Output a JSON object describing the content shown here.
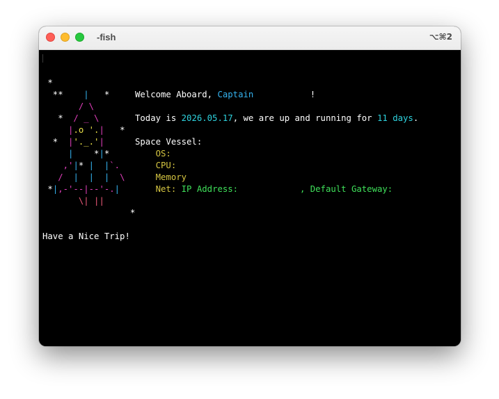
{
  "window": {
    "title": "-fish",
    "shortcut": "⌥⌘2"
  },
  "art": {
    "l1": [
      " *"
    ],
    "l2": [
      "  **    ",
      "|",
      "   *"
    ],
    "l3": [
      "       ",
      "/ \\"
    ],
    "l4": [
      "   *  ",
      "/ _ \\"
    ],
    "l5": [
      "     ",
      "|",
      ".o '.",
      "|",
      "   *"
    ],
    "l6": [
      "  *  ",
      "|",
      "'._.'",
      "|"
    ],
    "l7": [
      "     ",
      "|",
      "    *",
      "|",
      "*"
    ],
    "l8": [
      "    ",
      ",'",
      "|",
      "*",
      " ",
      "|",
      "  ",
      "|",
      "`.",
      ""
    ],
    "l9": [
      "   ",
      "/",
      "  ",
      "|",
      "  ",
      "|",
      "  ",
      "|",
      "  ",
      "\\"
    ],
    "l10": [
      " *",
      "|",
      ",-'--|--'-.",
      "|"
    ],
    "l11": [
      "       ",
      "\\| ||"
    ],
    "l12": [
      "                 *"
    ]
  },
  "info": {
    "welcome_prefix": "Welcome Aboard, ",
    "name": "Captain",
    "welcome_gap": "           ",
    "welcome_suffix": "!",
    "today_prefix": "Today is ",
    "date": "2026.05.17",
    "today_middle": ", we are up and running for ",
    "uptime": "11 days",
    "today_suffix": ".",
    "vessel_label": "Space Vessel:",
    "indent": "    ",
    "os_label": "OS:",
    "cpu_label": "CPU:",
    "memory_label": "Memory",
    "net_label": "Net:",
    "ip_label": " IP Address:",
    "ip_gap": "            ",
    "gateway_label": ", Default Gateway:"
  },
  "farewell": "Have a Nice Trip!",
  "colors": {
    "background": "#000000",
    "text": "#ffffff",
    "accent_blue": "#35b3f0",
    "accent_cyan": "#2ed3df",
    "accent_green": "#3fe05a",
    "accent_yellow": "#d6c642",
    "accent_magenta": "#e23fbd",
    "accent_red": "#ef5a7a"
  },
  "icons": {
    "close": "close-window-icon",
    "minimize": "minimize-window-icon",
    "maximize": "maximize-window-icon"
  }
}
